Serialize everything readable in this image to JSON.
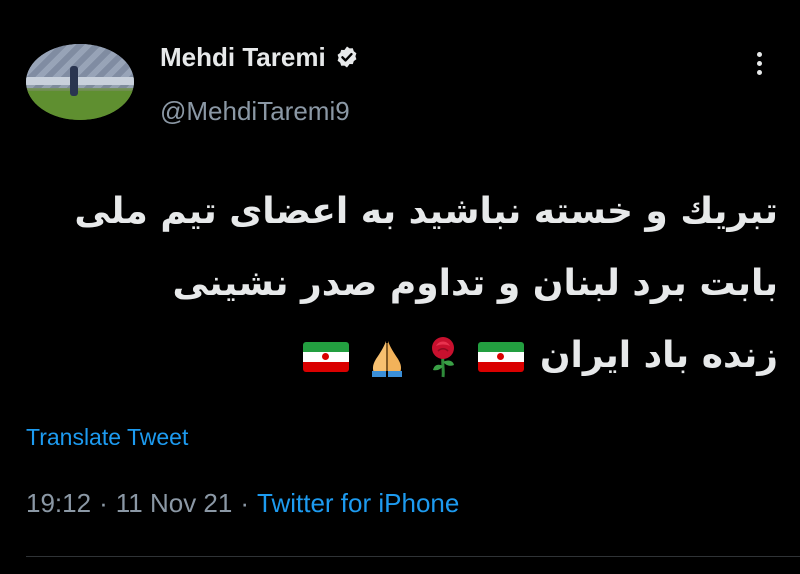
{
  "author": {
    "name": "Mehdi Taremi",
    "handle": "@MehdiTaremi9",
    "verified_icon": "verified-badge-icon",
    "avatar": "profile-photo-football-pitch"
  },
  "menu_icon": "more-options-icon",
  "tweet": {
    "lines": [
      "تبريك و خسته نباشيد به اعضای تيم ملی",
      "بابت برد لبنان و تداوم صدر نشينی",
      "زنده باد ايران"
    ],
    "emojis": [
      "flag-iran",
      "rose",
      "folded-hands",
      "flag-iran"
    ]
  },
  "translate_label": "Translate Tweet",
  "meta": {
    "time": "19:12",
    "separator": "·",
    "date": "11 Nov 21",
    "source": "Twitter for iPhone"
  },
  "colors": {
    "background": "#000000",
    "primary_text": "#e7e9ea",
    "secondary_text": "#8b98a5",
    "link": "#1d9bf0"
  }
}
